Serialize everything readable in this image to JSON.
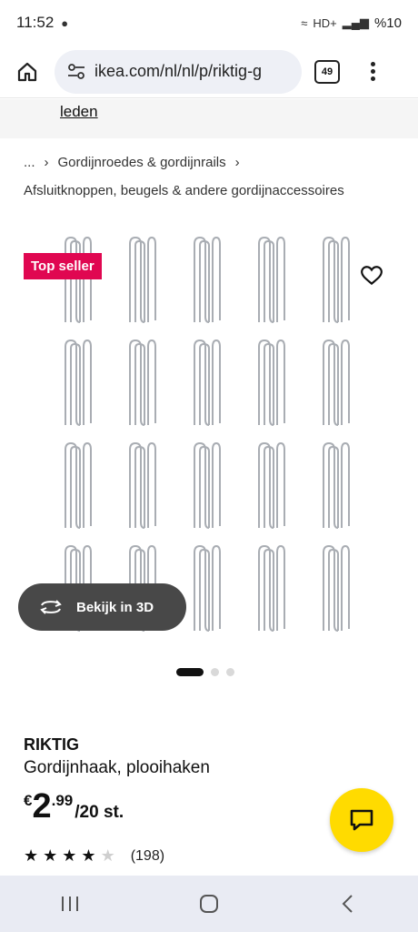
{
  "status_bar": {
    "time": "11:52",
    "battery": "%10",
    "network": "HD+"
  },
  "browser": {
    "url": "ikea.com/nl/nl/p/riktig-g",
    "tab_count": "49"
  },
  "banner": {
    "link_label": "leden"
  },
  "breadcrumb": {
    "ellipsis": "...",
    "level1": "Gordijnroedes & gordijnrails",
    "level2": "Afsluitknoppen, beugels & andere gordijnaccessoires"
  },
  "gallery": {
    "badge": "Top seller",
    "view_3d_label": "Bekijk in 3D",
    "slide_count": 3,
    "active_slide": 1
  },
  "product": {
    "name": "RIKTIG",
    "description": "Gordijnhaak, plooihaken",
    "price_currency": "€",
    "price_integer": "2",
    "price_decimal": ".99",
    "price_unit": "/20 st.",
    "rating": 4.5,
    "review_count": "(198)"
  },
  "colors": {
    "badge_red": "#e00751",
    "chat_yellow": "#ffdb00",
    "pill_dark": "#484848"
  }
}
